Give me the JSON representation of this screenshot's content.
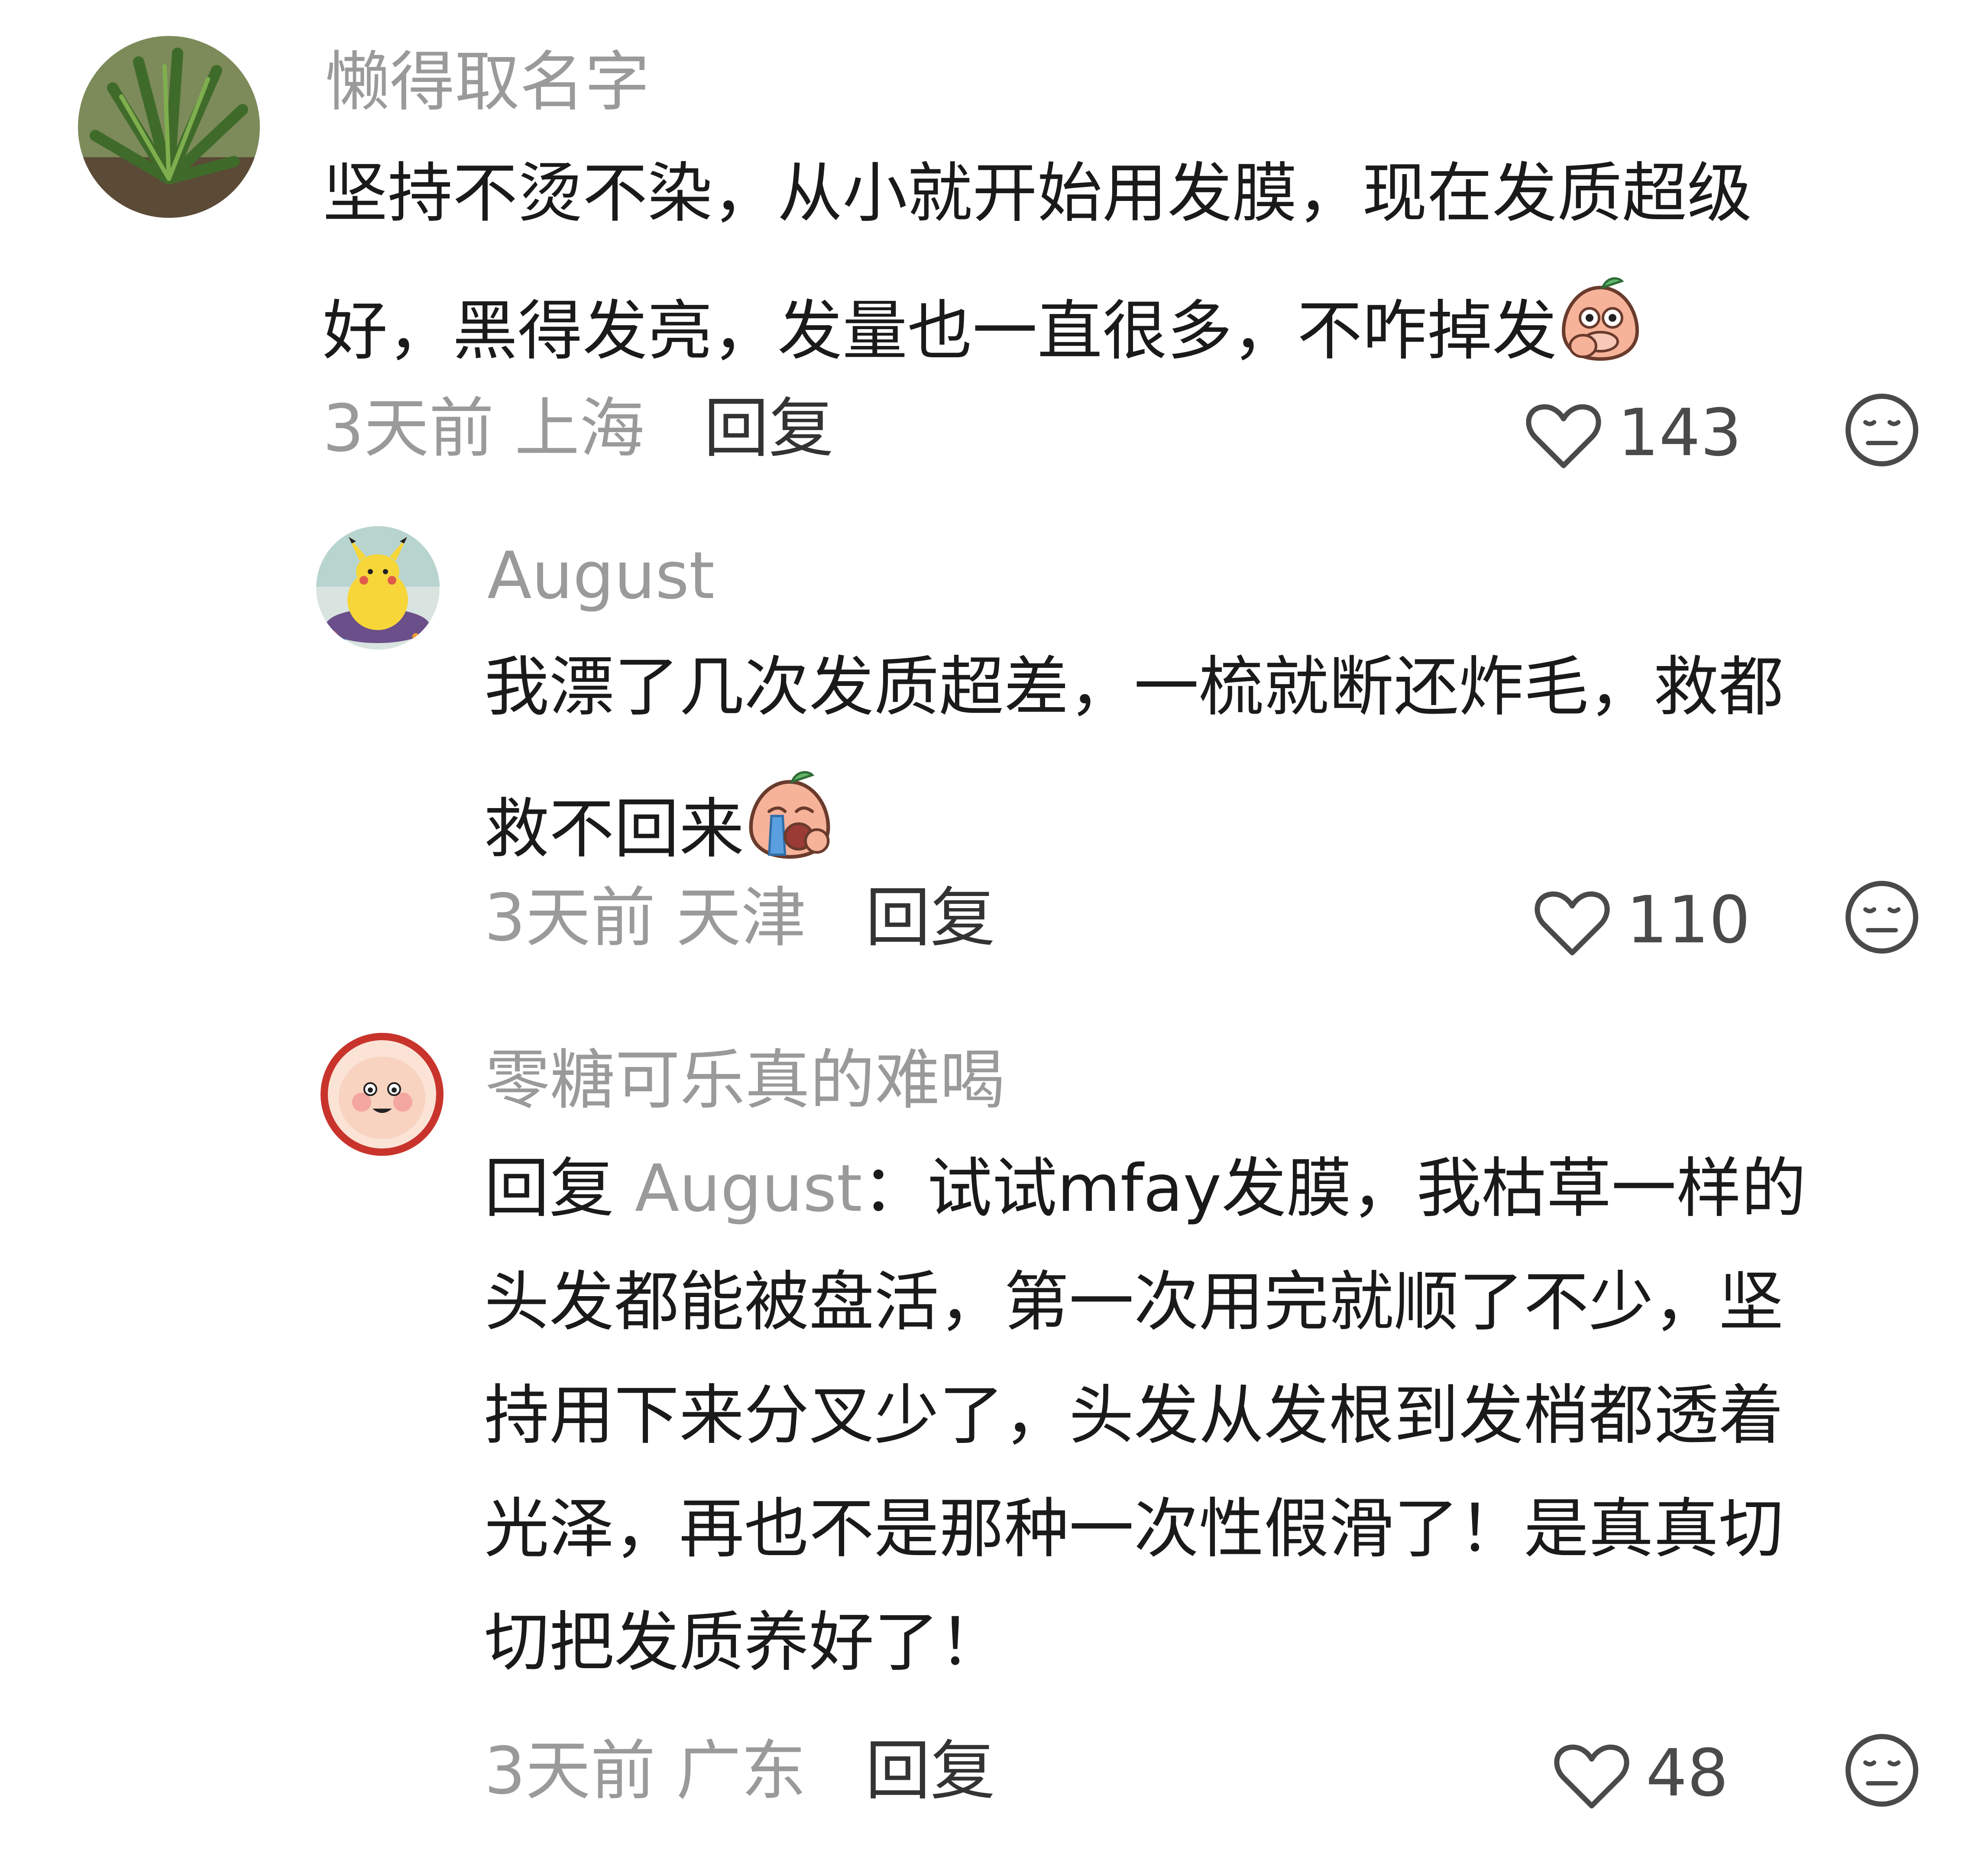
{
  "comments": [
    {
      "username": "懒得取名字",
      "lines": [
        "坚持不烫不染，从小就开始用发膜，现在发质超级",
        "好，黑得发亮，发量也一直很多，不咋掉发"
      ],
      "emoji": "peach-surprised-emoji",
      "time_location": "3天前 上海",
      "reply_label": "回复",
      "likes": "143",
      "avatar": "plant-avatar"
    },
    {
      "username": "August",
      "lines": [
        "我漂了几次发质超差，一梳就断还炸毛，救都",
        "救不回来"
      ],
      "emoji": "peach-crying-emoji",
      "time_location": "3天前 天津",
      "reply_label": "回复",
      "likes": "110",
      "avatar": "pikachu-avatar"
    },
    {
      "username": "零糖可乐真的难喝",
      "reply_prefix": "回复",
      "reply_to": "August",
      "reply_colon": "：",
      "first_line_rest": "试试mfay发膜，我枯草一样的",
      "lines": [
        "头发都能被盘活，第一次用完就顺了不少，坚",
        "持用下来分叉少了，头发从发根到发梢都透着",
        "光泽，再也不是那种一次性假滑了！是真真切",
        "切把发质养好了！"
      ],
      "time_location": "3天前 广东",
      "reply_label": "回复",
      "likes": "48",
      "avatar": "baby-face-avatar"
    }
  ],
  "colors": {
    "username": "#9a9a9a",
    "text": "#1a1a1a",
    "meta": "#9a9a9a",
    "icon": "#4a4a4a"
  },
  "icons": {
    "like": "heart-outline-icon",
    "dislike": "neutral-face-icon"
  }
}
